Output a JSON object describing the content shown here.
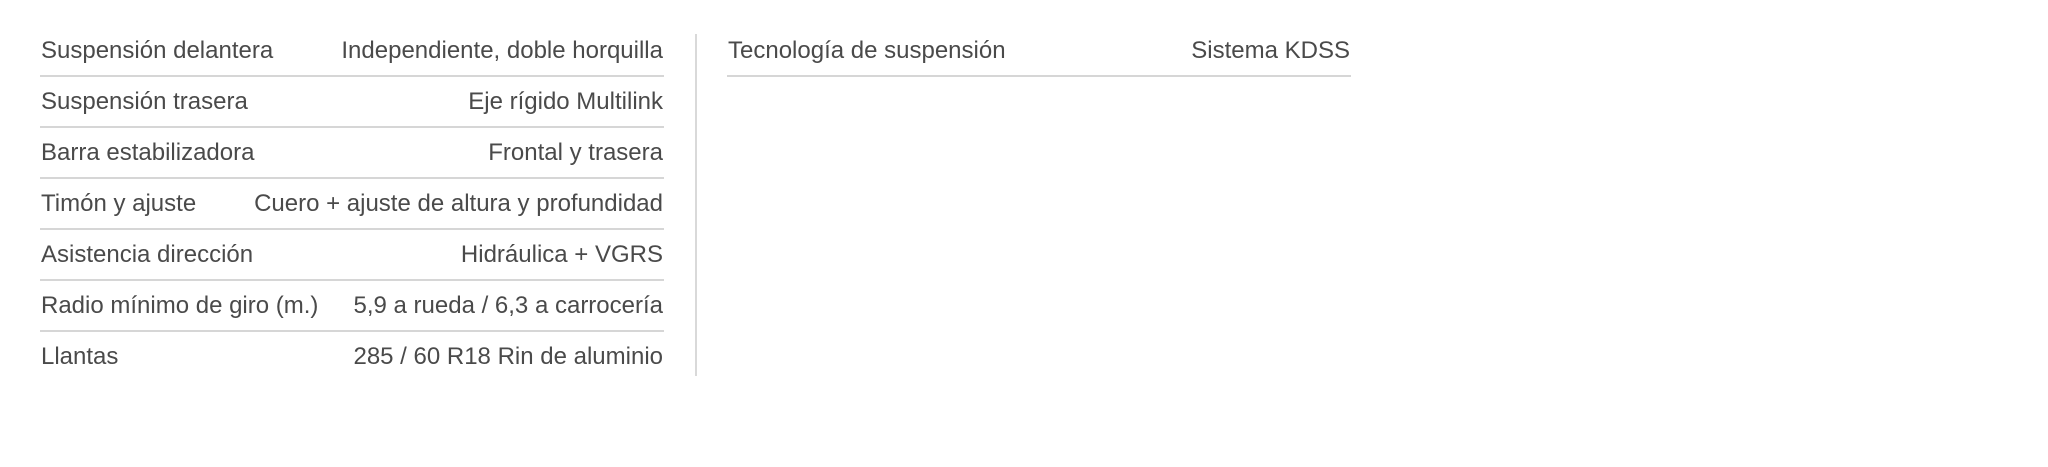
{
  "specs": {
    "left": [
      {
        "label": "Suspensión delantera",
        "value": "Independiente, doble horquilla"
      },
      {
        "label": "Suspensión trasera",
        "value": "Eje rígido Multilink"
      },
      {
        "label": "Barra estabilizadora",
        "value": "Frontal y trasera"
      },
      {
        "label": "Timón y ajuste",
        "value": "Cuero + ajuste de altura y profundidad"
      },
      {
        "label": "Asistencia dirección",
        "value": "Hidráulica + VGRS"
      },
      {
        "label": "Radio mínimo de giro (m.)",
        "value": "5,9 a rueda / 6,3 a carrocería"
      },
      {
        "label": "Llantas",
        "value": "285 / 60 R18 Rin de aluminio"
      }
    ],
    "right": [
      {
        "label": "Tecnología de suspensión",
        "value": "Sistema KDSS"
      }
    ]
  },
  "colors": {
    "text": "#4a4a4a",
    "rule": "#d6d6d6",
    "divider": "#d9d9d9"
  }
}
